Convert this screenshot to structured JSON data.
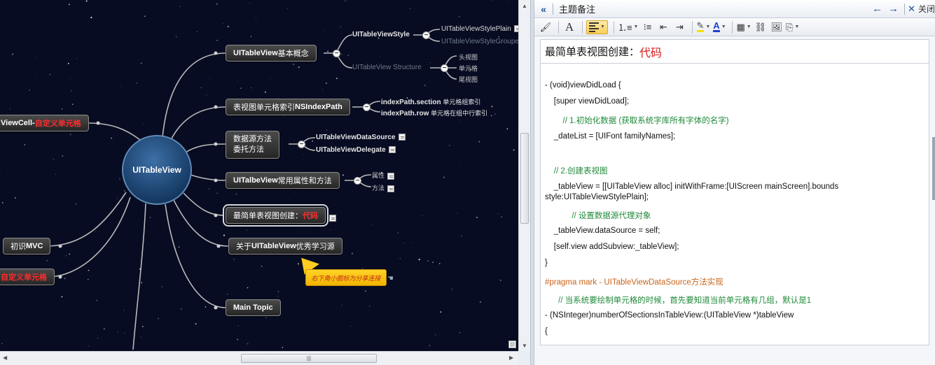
{
  "mindmap": {
    "central": "UITableView",
    "branches": {
      "basic_concept": {
        "bold": "UITableView",
        "rest": " 基本概念"
      },
      "index_path": {
        "rest": "表视图单元格索引",
        "bold": "NSIndexPath"
      },
      "datasource": {
        "line1": "数据源方法",
        "line2": "委托方法"
      },
      "common_attrs": {
        "bold": "UITalbeView",
        "rest": "常用属性和方法"
      },
      "simple_create": {
        "text": "最简单表视图创建：",
        "red": "代码"
      },
      "learn_resources": {
        "pre": "关于",
        "bold": "UITableView",
        "rest": "优秀学习源"
      },
      "main_topic": "Main Topic",
      "cell": {
        "bold": "ViewCell-",
        "red": "自定义单元格"
      },
      "mvc": {
        "pre": "初识",
        "bold": "MVC"
      },
      "left_red": "自定义单元格"
    },
    "leaves": {
      "style": "UITableViewStyle",
      "style_plain": "UITableViewStylePlain",
      "style_grouped": "UITableViewStyleGrouped",
      "structure": "UITableView Structure",
      "header_view": "头视图",
      "cell_view": "单元格",
      "footer_view": "尾视图",
      "ip_section": "indexPath.section",
      "ip_section_desc": "单元格组索引",
      "ip_row": "indexPath.row",
      "ip_row_desc": "单元格在组中行索引",
      "ds": "UITableViewDataSource",
      "delegate": "UITableViewDelegate",
      "attrs": "属性",
      "methods": "方法"
    },
    "callout": "右下角小图标为分享连接"
  },
  "notes": {
    "header_title": "主题备注",
    "close_label": "关闭",
    "title_text": "最简单表视图创建：",
    "title_red": "代码",
    "lines": [
      {
        "text": "- (void)viewDidLoad {",
        "kind": "code"
      },
      {
        "text": "    [super viewDidLoad];",
        "kind": "code"
      },
      {
        "text": "        // 1.初始化数据 (获取系统字库所有字体的名字)",
        "kind": "comment"
      },
      {
        "text": "    _dateList = [UIFont familyNames];",
        "kind": "code"
      },
      {
        "text": "    // 2.创建表视图",
        "kind": "comment"
      },
      {
        "text": "    _tableView = [[UITableView alloc] initWithFrame:[UIScreen mainScreen].bounds",
        "kind": "code"
      },
      {
        "text": "style:UITableViewStylePlain];",
        "kind": "code"
      },
      {
        "text": "            // 设置数据源代理对象",
        "kind": "comment"
      },
      {
        "text": "    _tableView.dataSource = self;",
        "kind": "code"
      },
      {
        "text": "    [self.view addSubview:_tableView];",
        "kind": "code"
      },
      {
        "text": "}",
        "kind": "code"
      },
      {
        "text": "#pragma mark - UITableViewDataSource方法实现",
        "kind": "pragma"
      },
      {
        "text": "      // 当系统要绘制单元格的时候，首先要知道当前单元格有几组，默认是1",
        "kind": "comment"
      },
      {
        "text": "- (NSInteger)numberOfSectionsInTableView:(UITableView *)tableView",
        "kind": "code"
      },
      {
        "text": "{",
        "kind": "code"
      }
    ]
  }
}
